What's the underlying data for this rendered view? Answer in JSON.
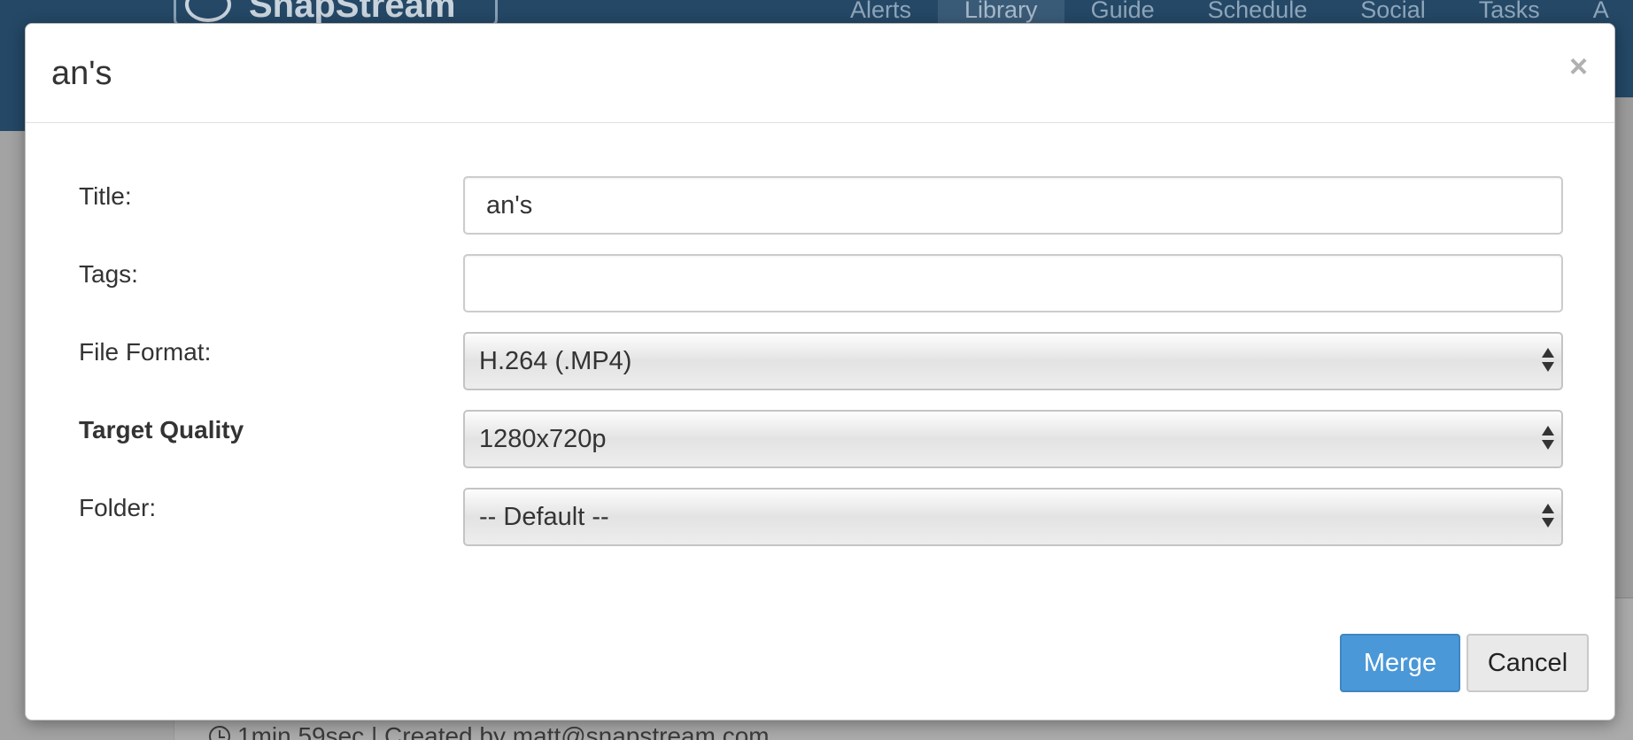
{
  "background": {
    "logo_text": "SnapStream",
    "nav_items": [
      "Alerts",
      "Library",
      "Guide",
      "Schedule",
      "Social",
      "Tasks",
      "A"
    ],
    "active_nav": "Library",
    "footer_text": "1min 59sec | Created by matt@snapstream.com"
  },
  "modal": {
    "title": "an's",
    "close_glyph": "×",
    "fields": {
      "title_label": "Title:",
      "title_value": "an's",
      "tags_label": "Tags:",
      "tags_value": "",
      "file_format_label": "File Format:",
      "file_format_value": "H.264 (.MP4)",
      "target_quality_label": "Target Quality",
      "target_quality_value": "1280x720p",
      "folder_label": "Folder:",
      "folder_value": "-- Default --"
    },
    "buttons": {
      "merge": "Merge",
      "cancel": "Cancel"
    }
  },
  "colors": {
    "primary_button": "#4a98d8",
    "header_bar": "#244866"
  }
}
